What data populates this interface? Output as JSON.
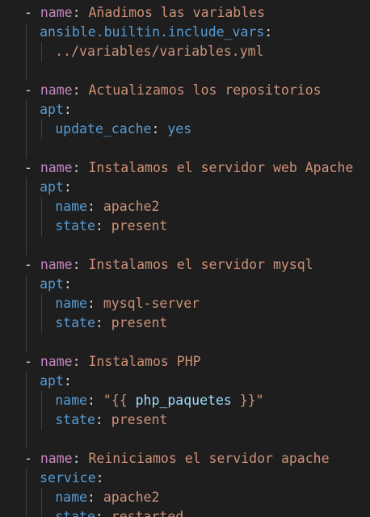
{
  "editor": {
    "colors": {
      "background": "#1e1e1e",
      "dash": "#d4d4d4",
      "task_key": "#c586c0",
      "module_key": "#569cd6",
      "string": "#ce9178",
      "boolean": "#569cd6",
      "template_variable": "#9cdcfe",
      "indent_guide": "#404040"
    },
    "tasks": [
      {
        "dash": "-",
        "name_key": "name",
        "colon": ":",
        "name_value": "Añadimos las variables",
        "module": "ansible.builtin.include_vars",
        "module_colon": ":",
        "args": [],
        "free_value": "../variables/variables.yml"
      },
      {
        "dash": "-",
        "name_key": "name",
        "colon": ":",
        "name_value": "Actualizamos los repositorios",
        "module": "apt",
        "module_colon": ":",
        "args": [
          {
            "key": "update_cache",
            "colon": ":",
            "value": "yes",
            "type": "bool"
          }
        ]
      },
      {
        "dash": "-",
        "name_key": "name",
        "colon": ":",
        "name_value": "Instalamos el servidor web Apache",
        "module": "apt",
        "module_colon": ":",
        "args": [
          {
            "key": "name",
            "colon": ":",
            "value": "apache2",
            "type": "str"
          },
          {
            "key": "state",
            "colon": ":",
            "value": "present",
            "type": "str"
          }
        ]
      },
      {
        "dash": "-",
        "name_key": "name",
        "colon": ":",
        "name_value": "Instalamos el servidor mysql",
        "module": "apt",
        "module_colon": ":",
        "args": [
          {
            "key": "name",
            "colon": ":",
            "value": "mysql-server",
            "type": "str"
          },
          {
            "key": "state",
            "colon": ":",
            "value": "present",
            "type": "str"
          }
        ]
      },
      {
        "dash": "-",
        "name_key": "name",
        "colon": ":",
        "name_value": "Instalamos PHP",
        "module": "apt",
        "module_colon": ":",
        "args": [
          {
            "key": "name",
            "colon": ":",
            "value_prefix": "\"{{ ",
            "value_var": "php_paquetes",
            "value_suffix": " }}\"",
            "type": "template"
          },
          {
            "key": "state",
            "colon": ":",
            "value": "present",
            "type": "str"
          }
        ]
      },
      {
        "dash": "-",
        "name_key": "name",
        "colon": ":",
        "name_value": "Reiniciamos el servidor apache",
        "module": "service",
        "module_colon": ":",
        "args": [
          {
            "key": "name",
            "colon": ":",
            "value": "apache2",
            "type": "str"
          },
          {
            "key": "state",
            "colon": ":",
            "value": "restarted",
            "type": "str"
          }
        ]
      }
    ]
  }
}
